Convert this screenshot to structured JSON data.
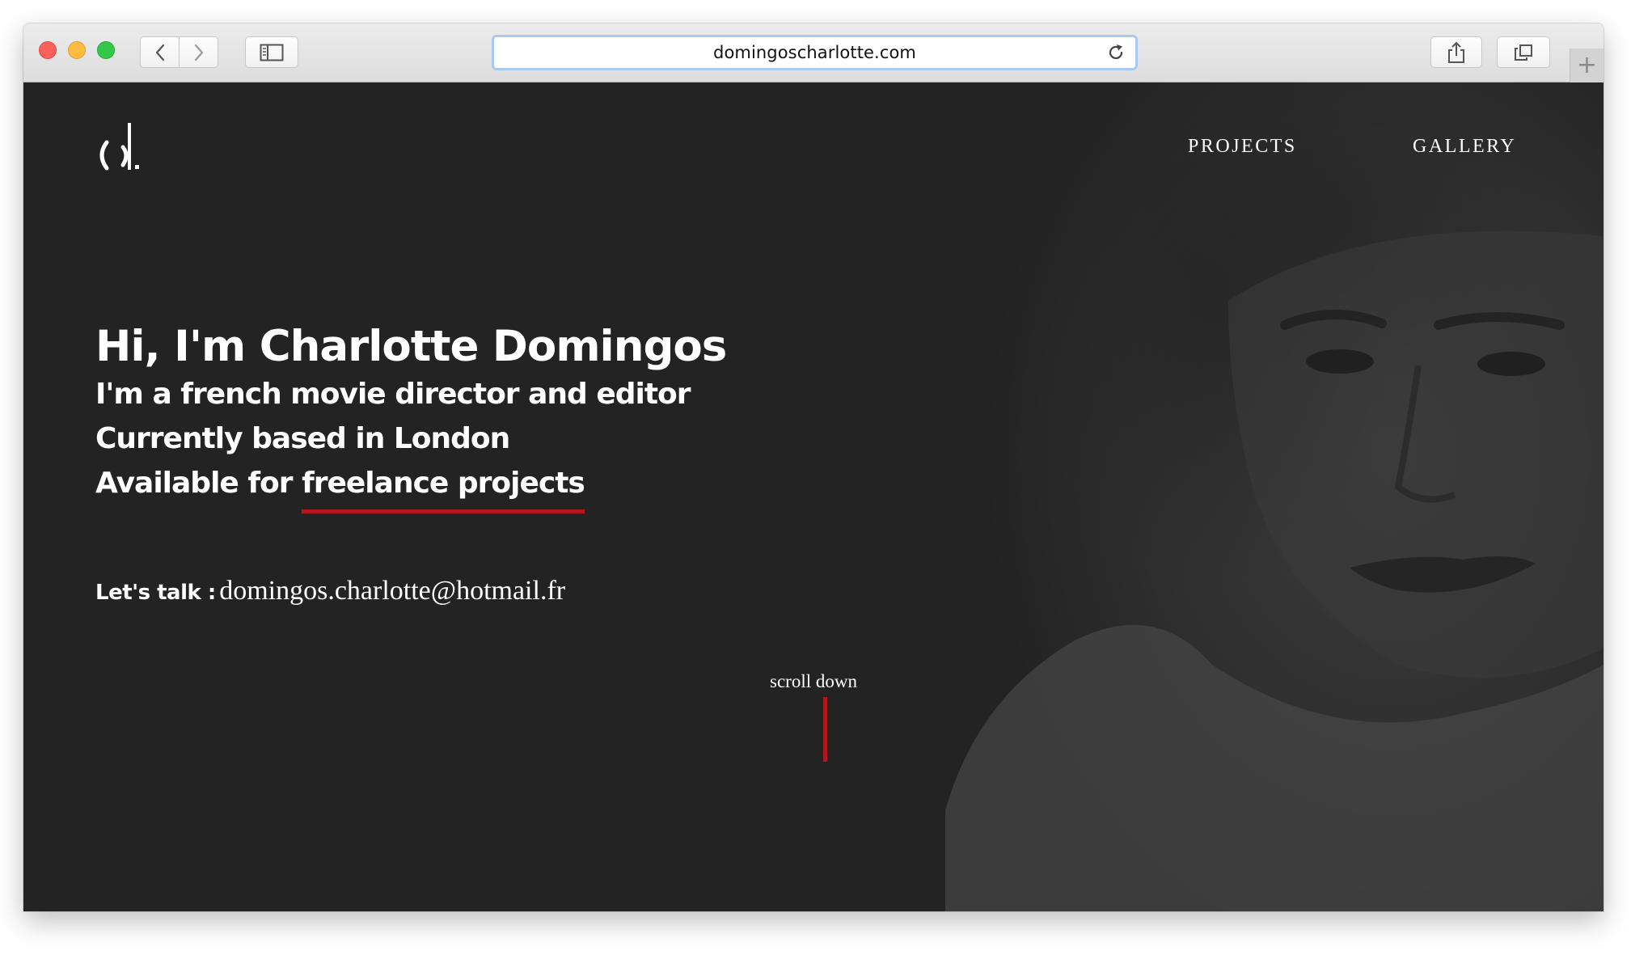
{
  "browser": {
    "url": "domingoscharlotte.com",
    "new_tab_label": "+"
  },
  "site": {
    "logo_text": "cd.",
    "nav": [
      {
        "label": "PROJECTS"
      },
      {
        "label": "GALLERY"
      }
    ],
    "hero": {
      "title": "Hi, I'm Charlotte Domingos",
      "line1": "I'm a french movie director and editor",
      "line2": "Currently based in London",
      "line3_prefix": "Available for ",
      "line3_highlight": "freelance projects"
    },
    "contact": {
      "label": "Let's talk :",
      "email": "domingos.charlotte@hotmail.fr"
    },
    "scroll_label": "scroll down"
  },
  "colors": {
    "page_background": "#232323",
    "accent_red": "#b3161c",
    "text": "#ffffff"
  },
  "icons": [
    "back-arrow-icon",
    "forward-arrow-icon",
    "sidebar-icon",
    "reload-icon",
    "share-icon",
    "tabs-overview-icon",
    "plus-icon"
  ]
}
